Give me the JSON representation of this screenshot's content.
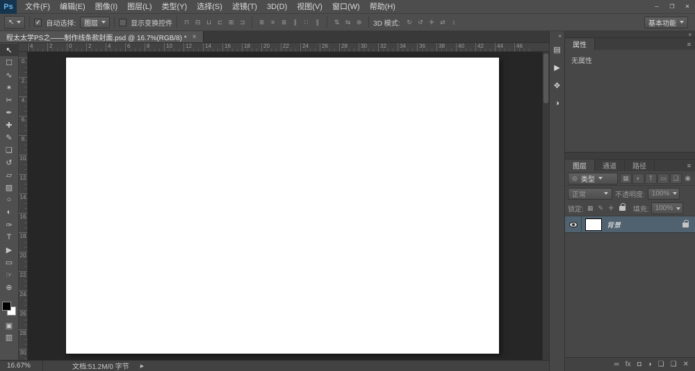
{
  "colors": {
    "ui_chrome": "#4d4d4d",
    "panel_background": "#474747",
    "canvas_background": "#262626",
    "canvas_white": "#ffffff",
    "selected_layer_highlight": "#50616f",
    "logo_blue": "#6cb5ea"
  },
  "window": {
    "logo": "Ps",
    "controls": {
      "minimize": "─",
      "restore": "❐",
      "close": "✕"
    }
  },
  "menu": {
    "items": [
      "文件(F)",
      "编辑(E)",
      "图像(I)",
      "图层(L)",
      "类型(Y)",
      "选择(S)",
      "滤镜(T)",
      "3D(D)",
      "视图(V)",
      "窗口(W)",
      "帮助(H)"
    ]
  },
  "options_bar": {
    "tool_preset_icon": "↖",
    "auto_select_label": "自动选择:",
    "auto_select_check": "✓",
    "target_dropdown": "图层",
    "show_transform_label": "显示变换控件",
    "align_icons": [
      {
        "name": "align-top-edges-icon",
        "glyph": "⊓"
      },
      {
        "name": "align-vertical-centers-icon",
        "glyph": "⊟"
      },
      {
        "name": "align-bottom-edges-icon",
        "glyph": "⊔"
      },
      {
        "name": "align-left-edges-icon",
        "glyph": "⊏"
      },
      {
        "name": "align-horizontal-centers-icon",
        "glyph": "⊞"
      },
      {
        "name": "align-right-edges-icon",
        "glyph": "⊐"
      }
    ],
    "distribute_icons": [
      {
        "name": "distribute-top-edges-icon",
        "glyph": "≣"
      },
      {
        "name": "distribute-vertical-centers-icon",
        "glyph": "≡"
      },
      {
        "name": "distribute-bottom-edges-icon",
        "glyph": "≣"
      },
      {
        "name": "distribute-left-edges-icon",
        "glyph": "∥"
      },
      {
        "name": "distribute-horizontal-centers-icon",
        "glyph": "∷"
      },
      {
        "name": "distribute-right-edges-icon",
        "glyph": "∥"
      }
    ],
    "arrange_icons": [
      {
        "name": "distribute-vertical-spacing-icon",
        "glyph": "⇅"
      },
      {
        "name": "distribute-horizontal-spacing-icon",
        "glyph": "⇆"
      },
      {
        "name": "auto-align-layers-icon",
        "glyph": "⊛"
      }
    ],
    "mode_3d_label": "3D 模式:",
    "mode_3d_icons": [
      {
        "name": "3d-rotate-icon",
        "glyph": "↻"
      },
      {
        "name": "3d-roll-icon",
        "glyph": "↺"
      },
      {
        "name": "3d-pan-icon",
        "glyph": "✛"
      },
      {
        "name": "3d-slide-icon",
        "glyph": "⇄"
      },
      {
        "name": "3d-scale-icon",
        "glyph": "↕"
      }
    ],
    "workspace_button": "基本功能"
  },
  "document_tab": {
    "title": "程太太学PS之——制作线条款封面.psd @ 16.7%(RGB/8) *",
    "close_icon": "×"
  },
  "toolbar": {
    "foreground_color": "#000000",
    "background_color": "#ffffff",
    "tools": [
      {
        "name": "move-tool",
        "glyph": "↖"
      },
      {
        "name": "marquee-tool",
        "glyph": "☐"
      },
      {
        "name": "lasso-tool",
        "glyph": "∿"
      },
      {
        "name": "quick-selection-tool",
        "glyph": "✶"
      },
      {
        "name": "crop-tool",
        "glyph": "✂"
      },
      {
        "name": "eyedropper-tool",
        "glyph": "✒"
      },
      {
        "name": "healing-brush-tool",
        "glyph": "✚"
      },
      {
        "name": "brush-tool",
        "glyph": "✎"
      },
      {
        "name": "clone-stamp-tool",
        "glyph": "❏"
      },
      {
        "name": "history-brush-tool",
        "glyph": "↺"
      },
      {
        "name": "eraser-tool",
        "glyph": "▱"
      },
      {
        "name": "gradient-tool",
        "glyph": "▨"
      },
      {
        "name": "blur-tool",
        "glyph": "○"
      },
      {
        "name": "dodge-tool",
        "glyph": "◐"
      },
      {
        "name": "pen-tool",
        "glyph": "✑"
      },
      {
        "name": "type-tool",
        "glyph": "T"
      },
      {
        "name": "path-selection-tool",
        "glyph": "▶"
      },
      {
        "name": "shape-tool",
        "glyph": "▭"
      },
      {
        "name": "hand-tool",
        "glyph": "☞"
      },
      {
        "name": "zoom-tool",
        "glyph": "⊕"
      }
    ],
    "extra": [
      {
        "name": "quick-mask-icon",
        "glyph": "▣"
      },
      {
        "name": "screen-mode-icon",
        "glyph": "▥"
      }
    ]
  },
  "rulers": {
    "horizontal": [
      "4",
      "2",
      "0",
      "2",
      "4",
      "6",
      "8",
      "10",
      "12",
      "14",
      "16",
      "18",
      "20",
      "22",
      "24",
      "26",
      "28",
      "30",
      "32",
      "34",
      "36",
      "38",
      "40",
      "42",
      "44",
      "46"
    ],
    "vertical": [
      "0",
      "2",
      "4",
      "6",
      "8",
      "10",
      "12",
      "14",
      "16",
      "18",
      "20",
      "22",
      "24",
      "26",
      "28",
      "30"
    ]
  },
  "status_bar": {
    "zoom": "16.67%",
    "doc_info": "文档:51.2M/0 字节",
    "flyout_icon": "▶"
  },
  "mini_dock": {
    "collapse_icon": "«",
    "panels": [
      {
        "name": "history-panel-icon",
        "glyph": "▤"
      },
      {
        "name": "actions-panel-icon",
        "glyph": "▶"
      },
      {
        "name": "styles-panel-icon",
        "glyph": "✥"
      },
      {
        "name": "adjustments-panel-icon",
        "glyph": "◑"
      }
    ]
  },
  "panel_dock": {
    "collapse_icon": "»",
    "properties": {
      "tab": "属性",
      "menu_icon": "≡",
      "empty_text": "无属性"
    },
    "layers": {
      "tabs": [
        {
          "name": "tab-layers",
          "label": "图层"
        },
        {
          "name": "tab-channels",
          "label": "通道"
        },
        {
          "name": "tab-paths",
          "label": "路径"
        }
      ],
      "menu_icon": "≡",
      "filter": {
        "picker_icon": "◎",
        "label": "类型",
        "icons": [
          {
            "name": "filter-pixel-layers-icon",
            "glyph": "▦"
          },
          {
            "name": "filter-adjustment-layers-icon",
            "glyph": "◐"
          },
          {
            "name": "filter-type-layers-icon",
            "glyph": "T"
          },
          {
            "name": "filter-shape-layers-icon",
            "glyph": "▭"
          },
          {
            "name": "filter-smart-objects-icon",
            "glyph": "❏"
          }
        ],
        "toggle_icon": "◉"
      },
      "blend_mode": "正常",
      "opacity_label": "不透明度:",
      "opacity_value": "100%",
      "lock_label": "锁定:",
      "lock_icons": [
        {
          "name": "lock-transparent-pixels-icon",
          "glyph": "▦"
        },
        {
          "name": "lock-image-pixels-icon",
          "glyph": "✎"
        },
        {
          "name": "lock-position-icon",
          "glyph": "✛"
        }
      ],
      "fill_label": "填充:",
      "fill_value": "100%",
      "layer": {
        "name": "背景"
      },
      "bottom_icons": [
        {
          "name": "link-layers-icon",
          "glyph": "∞"
        },
        {
          "name": "layer-styles-icon",
          "glyph": "fx"
        },
        {
          "name": "add-layer-mask-icon",
          "glyph": "◘"
        },
        {
          "name": "new-adjustment-layer-icon",
          "glyph": "◑"
        },
        {
          "name": "new-group-icon",
          "glyph": "❏"
        },
        {
          "name": "new-layer-icon",
          "glyph": "❑"
        },
        {
          "name": "delete-layer-icon",
          "glyph": "✕"
        }
      ]
    }
  }
}
